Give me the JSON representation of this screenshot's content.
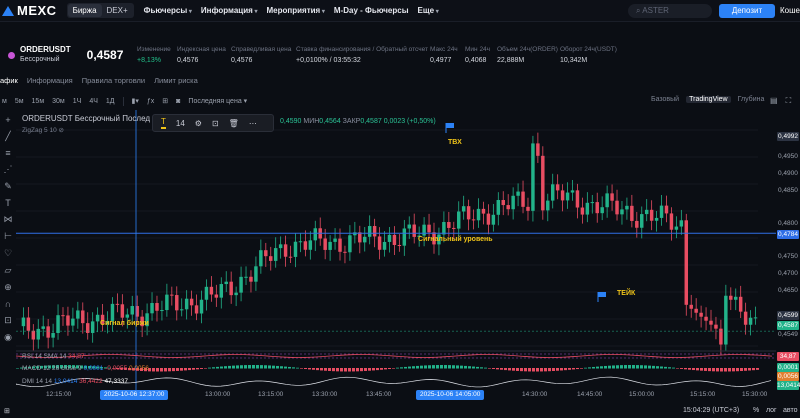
{
  "header": {
    "logo": "MEXC",
    "market_tabs": [
      "Биржа",
      "DEX+"
    ],
    "nav": [
      "Фьючерсы",
      "Информация",
      "Мероприятия",
      "M-Day - Фьючерсы",
      "Еще"
    ],
    "search_placeholder": "ASTER",
    "deposit_label": "Депозит",
    "account_label": "Коше"
  },
  "ticker": {
    "symbol": "ORDERUSDT",
    "type": "Бессрочный",
    "price": "0,4587",
    "stats": [
      {
        "label": "Изменение",
        "value": "+8,13%",
        "positive": true
      },
      {
        "label": "Индексная цена",
        "value": "0,4576"
      },
      {
        "label": "Справедливая цена",
        "value": "0,4576"
      },
      {
        "label": "Ставка финансирования / Обратный отсчет",
        "value": "+0,0100% / 03:55:32"
      },
      {
        "label": "Макс 24ч",
        "value": "0,4977"
      },
      {
        "label": "Мин 24ч",
        "value": "0,4068"
      },
      {
        "label": "Объем 24ч(ORDER)",
        "value": "22,888M"
      },
      {
        "label": "Оборот 24ч(USDT)",
        "value": "10,342M"
      }
    ]
  },
  "subtabs": [
    "афик",
    "Информация",
    "Правила торговли",
    "Лимит риска"
  ],
  "toolbar": {
    "intervals": [
      "м",
      "5м",
      "15м",
      "30м",
      "1Ч",
      "4Ч",
      "1Д"
    ],
    "price_type": "Последняя цена",
    "views": [
      "Базовый",
      "TradingView",
      "Глубина"
    ],
    "active_view": "TradingView"
  },
  "chart": {
    "title": "ORDERUSDT Бессрочный Послед",
    "zigzag": "ZigZag 5 10",
    "drawbar_size": "14",
    "ohlc": {
      "o": "0,4590",
      "l_label": "МИН",
      "l": "0,4564",
      "c_label": "ЗАКР",
      "c": "0,4587",
      "chg": "0,0023 (+0,50%)"
    },
    "yaxis": [
      "0,4950",
      "0,4900",
      "0,4850",
      "0,4800",
      "0,4750",
      "0,4700",
      "0,4650",
      "0,4600",
      "0,4549"
    ],
    "ybadges": {
      "top": "0,4992",
      "signal": "0,4784",
      "last": "0,4587",
      "lower": "0,4599"
    },
    "annotations": {
      "tvh": "ТВХ",
      "signal_level": "Сигнальный уровень",
      "signal_exchange": "Сигнал  биржи",
      "take": "ТЕЙК"
    },
    "indicators": {
      "rsi": "RSI 14 SMA 14",
      "rsi_val": "34,87",
      "rsi_badge": "34,87",
      "macd": "MACD 12 26 close 9",
      "macd_vals": [
        "0,0001",
        "-0,0055",
        "0,0056"
      ],
      "macd_badge": "0,0001",
      "macd_badge2": "0,0056",
      "dmi": "DMI 14 14",
      "dmi_vals": [
        "13,0414",
        "36,4422",
        "47,3337"
      ],
      "dmi_badge": "13,0414"
    },
    "xaxis": [
      "12:15:00",
      "13:00:00",
      "13:15:00",
      "13:30:00",
      "13:45:00",
      "14:30:00",
      "14:45:00",
      "15:00:00",
      "15:15:00",
      "15:30:00"
    ],
    "xbadges": [
      "2025-10-06",
      "12:37:00",
      "2025-10-06",
      "14:05:00"
    ],
    "chart_data": {
      "type": "candlestick",
      "title": "ORDERUSDT Бессрочный",
      "x": [
        "12:15",
        "12:30",
        "12:45",
        "13:00",
        "13:15",
        "13:30",
        "13:45",
        "14:00",
        "14:15",
        "14:30",
        "14:45",
        "15:00"
      ],
      "y": [
        0.4585,
        0.461,
        0.463,
        0.466,
        0.476,
        0.477,
        0.478,
        0.483,
        0.486,
        0.483,
        0.48,
        0.4587
      ],
      "ylim": [
        0.4549,
        0.4992
      ],
      "signal_level": 0.4784,
      "last_price": 0.4587
    }
  },
  "bottom": {
    "time": "15:04:29 (UTC+3)",
    "pct": "%",
    "log": "лог",
    "auto": "авто"
  },
  "colors": {
    "up": "#22b38a",
    "down": "#e84d62",
    "accent": "#2c82f6",
    "signal": "#2f6ee6"
  }
}
